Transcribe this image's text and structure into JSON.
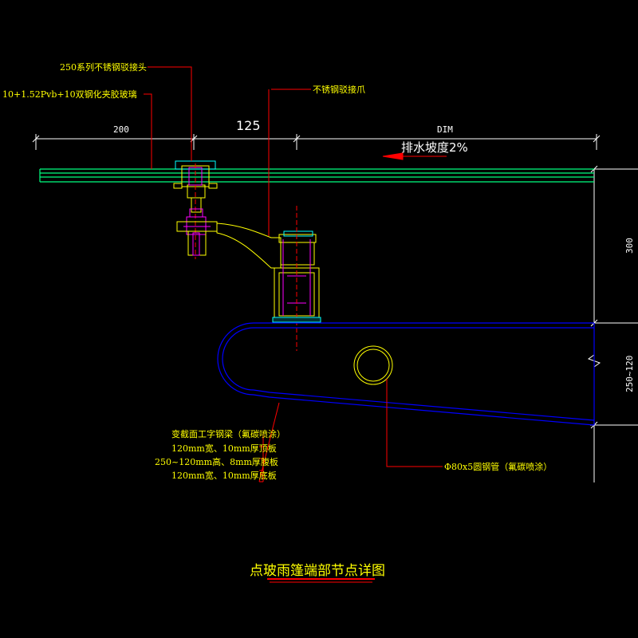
{
  "labels": {
    "joint_head": "250系列不锈钢驳接头",
    "glass": "10+1.52Pvb+10双钢化夹胶玻璃",
    "claw": "不锈钢驳接爪",
    "slope": "排水坡度2%",
    "beam_title": "变截面工字钢梁（氟碳喷涂）",
    "beam_top": "120mm宽、10mm厚顶板",
    "beam_web": "250~120mm高、8mm厚腹板",
    "beam_bottom": "120mm宽、10mm厚底板",
    "pipe": "Φ80x5圆钢管（氟碳喷涂）"
  },
  "dimensions": {
    "d200": "200",
    "d125": "125",
    "dim": "DIM",
    "v300": "300",
    "v250": "250~120"
  },
  "title": "点玻雨篷端部节点详图",
  "colors": {
    "background": "#000000",
    "text": "#ffff00",
    "glass": "#00ff7f",
    "beam": "#0000ff",
    "fitting": "#ffff00",
    "bolt": "#ff00ff",
    "leader": "#ff0000",
    "dimension": "#ffffff"
  }
}
